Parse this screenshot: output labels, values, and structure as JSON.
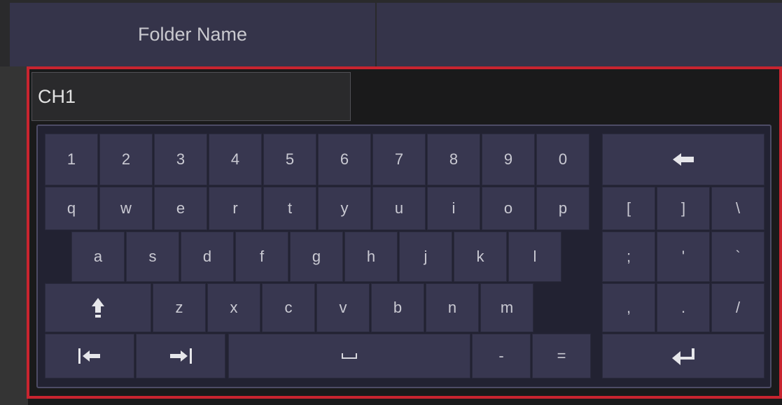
{
  "header": {
    "folder_name_label": "Folder Name"
  },
  "input": {
    "value": "CH1"
  },
  "keyboard": {
    "digits": [
      "1",
      "2",
      "3",
      "4",
      "5",
      "6",
      "7",
      "8",
      "9",
      "0"
    ],
    "row_q": [
      "q",
      "w",
      "e",
      "r",
      "t",
      "y",
      "u",
      "i",
      "o",
      "p"
    ],
    "row_a": [
      "a",
      "s",
      "d",
      "f",
      "g",
      "h",
      "j",
      "k",
      "l"
    ],
    "row_z": [
      "z",
      "x",
      "c",
      "v",
      "b",
      "n",
      "m"
    ],
    "brackets": [
      "[",
      "]",
      "\\"
    ],
    "punct1": [
      ";",
      "'",
      "`"
    ],
    "punct2": [
      ",",
      ".",
      "/"
    ],
    "dash": "-",
    "equals": "=",
    "icons": {
      "backspace": "backspace-arrow-icon",
      "shift": "shift-up-arrow-icon",
      "tab_left": "tab-left-icon",
      "tab_right": "tab-right-icon",
      "space": "space-bar-icon",
      "enter": "enter-return-icon"
    }
  },
  "colors": {
    "highlight": "#c8242f",
    "key": "#383750",
    "header": "#35344a"
  }
}
